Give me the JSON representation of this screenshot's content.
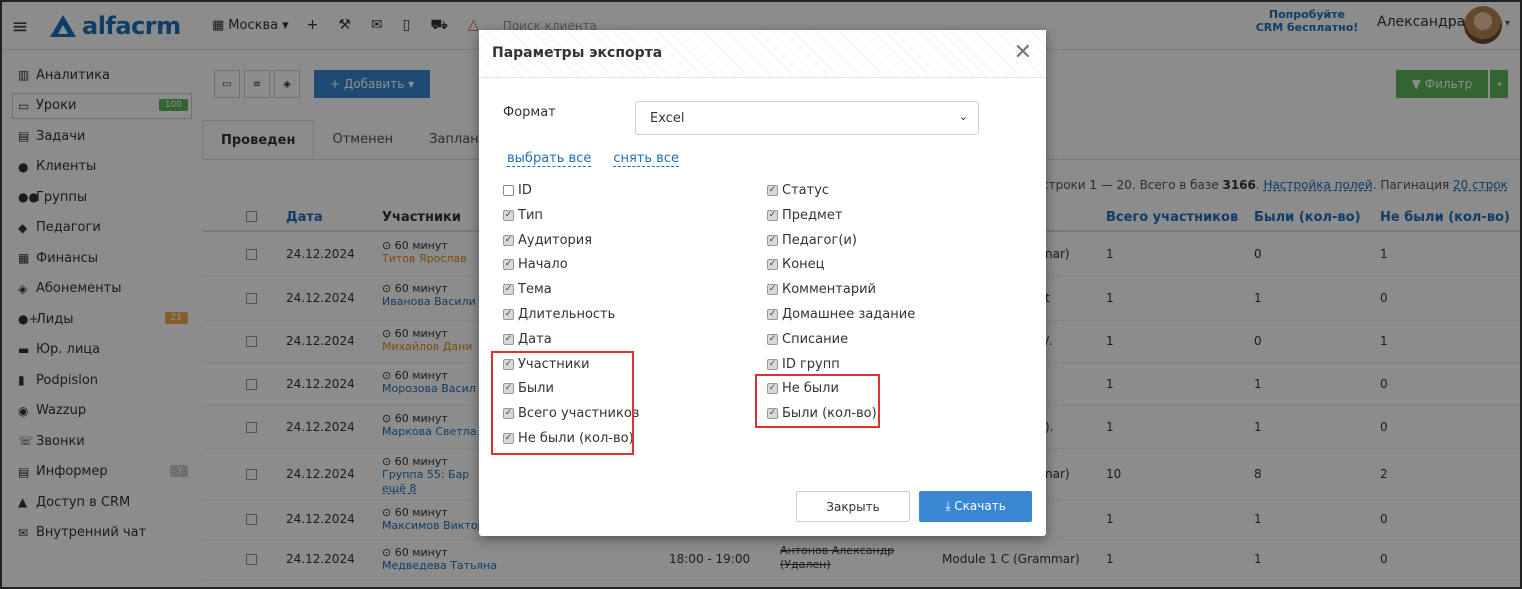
{
  "topbar": {
    "logo_text": "alfacrm",
    "city": "Москва",
    "city_caret": "▾",
    "search_placeholder": "Поиск клиента",
    "try_line1": "Попробуйте",
    "try_line2": "CRM бесплатно!",
    "user_name": "Александра",
    "user_caret": "▾"
  },
  "sidebar": {
    "items": [
      {
        "icon": "▥",
        "label": "Аналитика"
      },
      {
        "icon": "▭",
        "label": "Уроки",
        "badge": "100"
      },
      {
        "icon": "▤",
        "label": "Задачи"
      },
      {
        "icon": "●",
        "label": "Клиенты"
      },
      {
        "icon": "●●",
        "label": "Группы"
      },
      {
        "icon": "◆",
        "label": "Педагоги"
      },
      {
        "icon": "▦",
        "label": "Финансы"
      },
      {
        "icon": "◈",
        "label": "Абонементы"
      },
      {
        "icon": "●+",
        "label": "Лиды",
        "badge": "21"
      },
      {
        "icon": "▬",
        "label": "Юр. лица"
      },
      {
        "icon": "▮",
        "label": "Podpislon"
      },
      {
        "icon": "◉",
        "label": "Wazzup"
      },
      {
        "icon": "☏",
        "label": "Звонки"
      },
      {
        "icon": "▤",
        "label": "Информер",
        "badge": "3"
      },
      {
        "icon": "▲",
        "label": "Доступ в CRM"
      },
      {
        "icon": "✉",
        "label": "Внутренний чат"
      }
    ]
  },
  "main": {
    "add_label": "+ Добавить ▾",
    "filter_label": "▼ Фильтр",
    "filter_caret": "▾",
    "tabs": [
      "Проведен",
      "Отменен",
      "Запланирован"
    ],
    "info": {
      "rows_text": "строки 1 — 20. Всего в базе ",
      "total": "3166",
      "dot": ".",
      "fields_link": "Настройка полей",
      "pagination_text": ". Пагинация ",
      "pagination_link": "20 строк"
    },
    "columns": {
      "date": "Дата",
      "participants": "Участники",
      "total": "Всего участников",
      "were": "Были (кол-во)",
      "werenot": "Не были (кол-во)"
    },
    "rows": [
      {
        "date": "24.12.2024",
        "dur": "⊙ 60 минут",
        "name": "Титов Ярослав",
        "orange": true,
        "extra": "nar)",
        "total": "1",
        "were": "0",
        "werenot": "1"
      },
      {
        "date": "24.12.2024",
        "dur": "⊙ 60 минут",
        "name": "Иванова Васили",
        "orange": false,
        "extra": "t",
        "total": "1",
        "were": "1",
        "werenot": "0"
      },
      {
        "date": "24.12.2024",
        "dur": "⊙ 60 минут",
        "name": "Михайлов Дани",
        "orange": true,
        "extra": "/.",
        "total": "1",
        "were": "0",
        "werenot": "1"
      },
      {
        "date": "24.12.2024",
        "dur": "⊙ 60 минут",
        "name": "Морозова Васил",
        "orange": false,
        "extra": "",
        "total": "1",
        "were": "1",
        "werenot": "0"
      },
      {
        "date": "24.12.2024",
        "dur": "⊙ 60 минут",
        "name": "Маркова Светла",
        "orange": false,
        "extra": ").",
        "total": "1",
        "were": "1",
        "werenot": "0"
      },
      {
        "date": "24.12.2024",
        "dur": "⊙ 60 минут",
        "name": "Группа 55: Бар",
        "orange": false,
        "more": "ещё 8",
        "extra": "nar)",
        "total": "10",
        "were": "8",
        "werenot": "2"
      },
      {
        "date": "24.12.2024",
        "dur": "⊙ 60 минут",
        "name": "Максимов Виктор",
        "orange": false,
        "extra": "",
        "total": "1",
        "were": "1",
        "werenot": "0"
      },
      {
        "date": "24.12.2024",
        "dur": "⊙ 60 минут",
        "name": "Медведева Татьяна",
        "orange": false,
        "time": "18:00 - 19:00",
        "teacher": "Антонов Александр",
        "teacher2": "(Удален)",
        "subject": "Module 1 C (Grammar)",
        "total": "1",
        "were": "1",
        "werenot": "0"
      }
    ]
  },
  "modal": {
    "title": "Параметры экспорта",
    "close_glyph": "✕",
    "format_label": "Формат",
    "format_value": "Excel",
    "format_caret": "⌄",
    "select_all": "выбрать все",
    "deselect_all": "снять все",
    "left_fields": [
      {
        "label": "ID",
        "checked": false
      },
      {
        "label": "Тип",
        "checked": true
      },
      {
        "label": "Аудитория",
        "checked": true
      },
      {
        "label": "Начало",
        "checked": true
      },
      {
        "label": "Тема",
        "checked": true
      },
      {
        "label": "Длительность",
        "checked": true
      },
      {
        "label": "Дата",
        "checked": true
      },
      {
        "label": "Участники",
        "checked": true
      },
      {
        "label": "Были",
        "checked": true
      },
      {
        "label": "Всего участников",
        "checked": true
      },
      {
        "label": "Не были (кол-во)",
        "checked": true
      }
    ],
    "right_fields": [
      {
        "label": "Статус",
        "checked": true
      },
      {
        "label": "Предмет",
        "checked": true
      },
      {
        "label": "Педагог(и)",
        "checked": true
      },
      {
        "label": "Конец",
        "checked": true
      },
      {
        "label": "Комментарий",
        "checked": true
      },
      {
        "label": "Домашнее задание",
        "checked": true
      },
      {
        "label": "Списание",
        "checked": true
      },
      {
        "label": "ID групп",
        "checked": true
      },
      {
        "label": "Не были",
        "checked": true
      },
      {
        "label": "Были (кол-во)",
        "checked": true
      }
    ],
    "close_button": "Закрыть",
    "download_button": "⤓ Скачать",
    "highlight_color": "#d9342f"
  }
}
